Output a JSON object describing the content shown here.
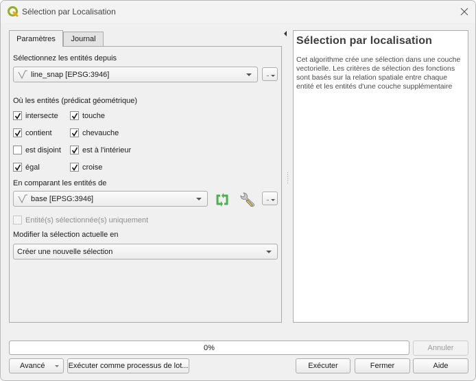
{
  "window": {
    "title": "Sélection par Localisation"
  },
  "tabs": [
    {
      "label": "Paramètres",
      "active": true
    },
    {
      "label": "Journal",
      "active": false
    }
  ],
  "form": {
    "source_label": "Sélectionnez les entités depuis",
    "source_layer": "line_snap [EPSG:3946]",
    "predicate_label": "Où les entités (prédicat géométrique)",
    "predicates": [
      {
        "label": "intersecte",
        "checked": true
      },
      {
        "label": "touche",
        "checked": true
      },
      {
        "label": "contient",
        "checked": true
      },
      {
        "label": "chevauche",
        "checked": true
      },
      {
        "label": "est disjoint",
        "checked": false
      },
      {
        "label": "est à l'intérieur",
        "checked": true
      },
      {
        "label": "égal",
        "checked": true
      },
      {
        "label": "croise",
        "checked": true
      }
    ],
    "compare_label": "En comparant les entités de",
    "compare_layer": "base [EPSG:3946]",
    "selected_only_label": "Entité(s) sélectionnée(s) uniquement",
    "selected_only_checked": false,
    "modify_label": "Modifier la sélection actuelle en",
    "modify_value": "Créer une nouvelle sélection",
    "more_button": "..."
  },
  "help": {
    "title": "Sélection par localisation",
    "text": "Cet algorithme crée une sélection dans une couche vectorielle. Les critères de sélection des fonctions sont basés sur la relation spatiale entre chaque entité et les entités d'une couche supplémentaire"
  },
  "progress": {
    "value_percent": 0,
    "label": "0%"
  },
  "buttons": {
    "cancel": "Annuler",
    "advanced": "Avancé",
    "batch": "Exécuter comme processus de lot...",
    "run": "Exécuter",
    "close": "Fermer",
    "help": "Aide"
  },
  "colors": {
    "qgis_green": "#93b023",
    "iterate_green": "#4caf50",
    "wrench_handle": "#e8c24a"
  }
}
